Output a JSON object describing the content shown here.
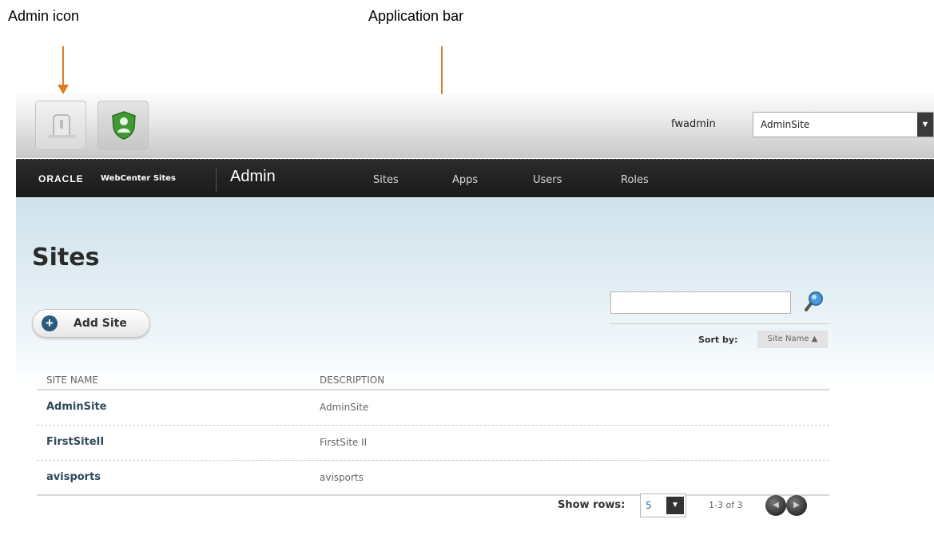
{
  "annotations": {
    "admin_icon_label": "Admin icon",
    "application_bar_label": "Application bar",
    "arrow_color": "#e07b22"
  },
  "app_bar": {
    "icons": [
      "admin-icon",
      "contributor-icon"
    ],
    "username": "fwadmin",
    "site_selector_value": "AdminSite"
  },
  "nav": {
    "brand_oracle": "ORACLE",
    "brand_product": "WebCenter Sites",
    "title": "Admin",
    "items": [
      "Sites",
      "Apps",
      "Users",
      "Roles"
    ]
  },
  "page": {
    "title": "Sites",
    "add_button": "Add Site",
    "search_placeholder": "",
    "sort_label": "Sort by:",
    "sort_value": "Site Name ▲",
    "columns": [
      "SITE NAME",
      "DESCRIPTION"
    ],
    "rows": [
      {
        "name": "AdminSite",
        "description": "AdminSite"
      },
      {
        "name": "FirstSiteII",
        "description": "FirstSite II"
      },
      {
        "name": "avisports",
        "description": "avisports"
      }
    ],
    "show_rows_label": "Show rows:",
    "show_rows_value": "5",
    "range_text": "1-3 of 3"
  },
  "colors": {
    "nav_bg": "#1f1f1f",
    "accent_blue": "#2c5a7d",
    "content_gradient_top": "#cfe2ec",
    "contributor_shield_green": "#3f9a34"
  }
}
